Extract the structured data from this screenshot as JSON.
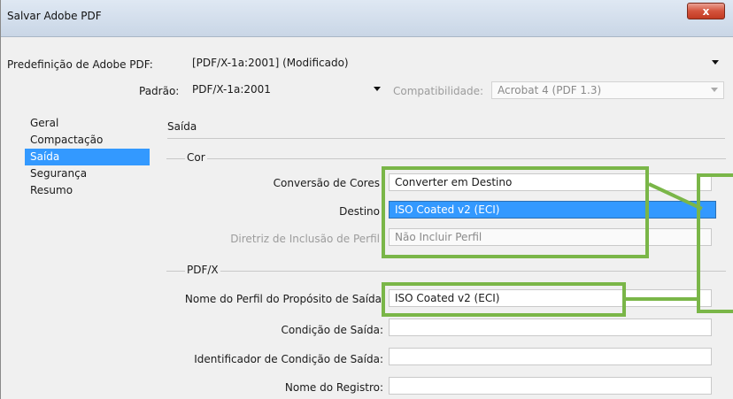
{
  "window": {
    "title": "Salvar Adobe PDF",
    "close_symbol": "x"
  },
  "preset": {
    "label": "Predefinição de Adobe PDF:",
    "value": "[PDF/X-1a:2001] (Modificado)"
  },
  "standard": {
    "label": "Padrão:",
    "value": "PDF/X-1a:2001"
  },
  "compatibility": {
    "label": "Compatibilidade:",
    "value": "Acrobat 4 (PDF 1.3)"
  },
  "sidebar": {
    "items": [
      {
        "label": "Geral"
      },
      {
        "label": "Compactação"
      },
      {
        "label": "Saída",
        "active": true
      },
      {
        "label": "Segurança"
      },
      {
        "label": "Resumo"
      }
    ]
  },
  "section": {
    "title": "Saída"
  },
  "color_group": {
    "legend": "Cor",
    "conversion": {
      "label": "Conversão de Cores",
      "value": "Converter em Destino"
    },
    "destination": {
      "label": "Destino",
      "value": "ISO Coated v2 (ECI)"
    },
    "profile_policy": {
      "label": "Diretriz de Inclusão de Perfil",
      "value": "Não Incluir Perfil"
    }
  },
  "pdfx_group": {
    "legend": "PDF/X",
    "output_intent_profile": {
      "label": "Nome do Perfil do Propósito de Saída",
      "value": "ISO Coated v2 (ECI)"
    },
    "output_condition": {
      "label": "Condição de Saída:",
      "value": ""
    },
    "output_condition_id": {
      "label": "Identificador de Condição de Saída:",
      "value": ""
    },
    "registry_name": {
      "label": "Nome do Registro:",
      "value": ""
    }
  },
  "colors": {
    "selection": "#3399ff",
    "highlight": "#7ab648"
  }
}
